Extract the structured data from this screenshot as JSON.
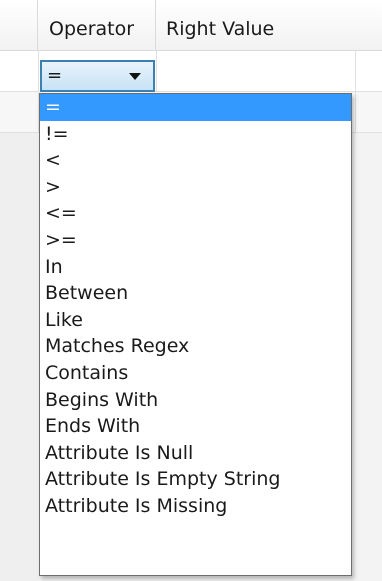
{
  "header": {
    "operator_label": "Operator",
    "right_value_label": "Right Value"
  },
  "combo": {
    "selected_value": "="
  },
  "dropdown": {
    "selected_index": 0,
    "options": [
      "=",
      "!=",
      "<",
      ">",
      "<=",
      ">=",
      "In",
      "Between",
      "Like",
      "Matches Regex",
      "Contains",
      "Begins With",
      "Ends With",
      "Attribute Is Null",
      "Attribute Is Empty String",
      "Attribute Is Missing"
    ]
  },
  "colors": {
    "selection": "#3399ff",
    "combo_border": "#3c7fb1"
  },
  "icons": {
    "combo_arrow": "chevron-down-icon"
  }
}
